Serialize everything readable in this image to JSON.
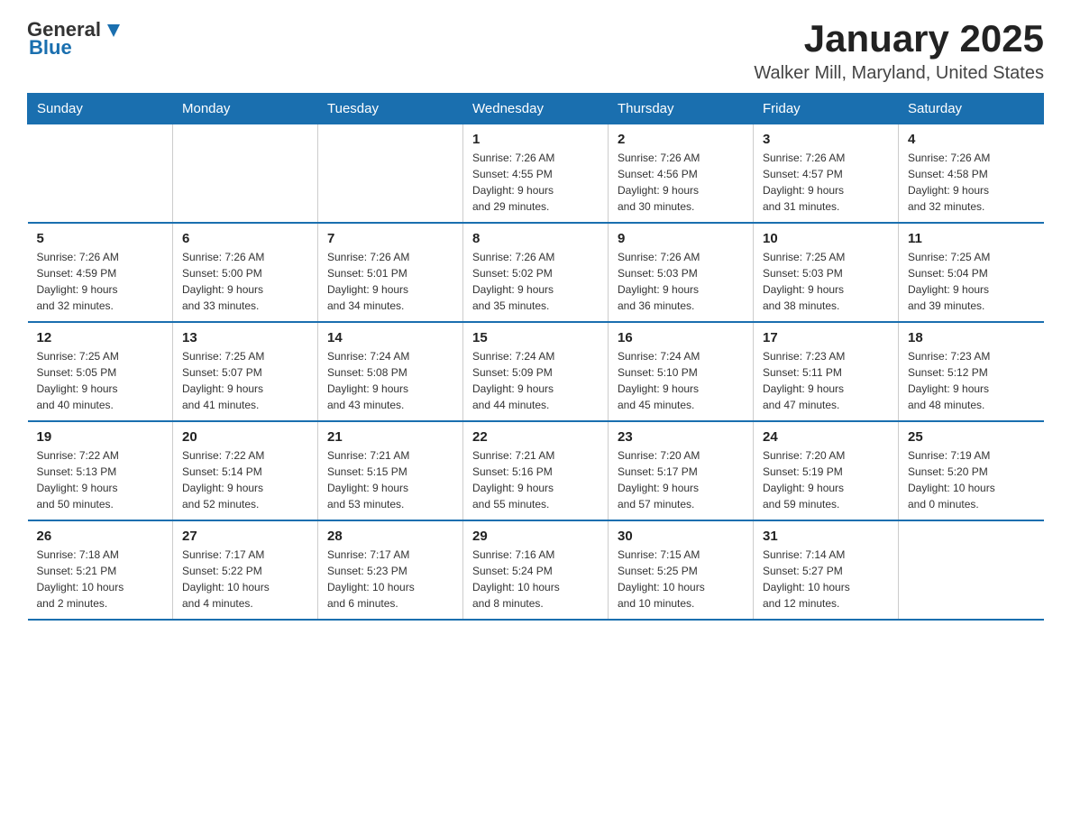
{
  "logo": {
    "general": "General",
    "blue": "Blue"
  },
  "title": "January 2025",
  "location": "Walker Mill, Maryland, United States",
  "weekdays": [
    "Sunday",
    "Monday",
    "Tuesday",
    "Wednesday",
    "Thursday",
    "Friday",
    "Saturday"
  ],
  "weeks": [
    [
      {
        "day": "",
        "info": ""
      },
      {
        "day": "",
        "info": ""
      },
      {
        "day": "",
        "info": ""
      },
      {
        "day": "1",
        "info": "Sunrise: 7:26 AM\nSunset: 4:55 PM\nDaylight: 9 hours\nand 29 minutes."
      },
      {
        "day": "2",
        "info": "Sunrise: 7:26 AM\nSunset: 4:56 PM\nDaylight: 9 hours\nand 30 minutes."
      },
      {
        "day": "3",
        "info": "Sunrise: 7:26 AM\nSunset: 4:57 PM\nDaylight: 9 hours\nand 31 minutes."
      },
      {
        "day": "4",
        "info": "Sunrise: 7:26 AM\nSunset: 4:58 PM\nDaylight: 9 hours\nand 32 minutes."
      }
    ],
    [
      {
        "day": "5",
        "info": "Sunrise: 7:26 AM\nSunset: 4:59 PM\nDaylight: 9 hours\nand 32 minutes."
      },
      {
        "day": "6",
        "info": "Sunrise: 7:26 AM\nSunset: 5:00 PM\nDaylight: 9 hours\nand 33 minutes."
      },
      {
        "day": "7",
        "info": "Sunrise: 7:26 AM\nSunset: 5:01 PM\nDaylight: 9 hours\nand 34 minutes."
      },
      {
        "day": "8",
        "info": "Sunrise: 7:26 AM\nSunset: 5:02 PM\nDaylight: 9 hours\nand 35 minutes."
      },
      {
        "day": "9",
        "info": "Sunrise: 7:26 AM\nSunset: 5:03 PM\nDaylight: 9 hours\nand 36 minutes."
      },
      {
        "day": "10",
        "info": "Sunrise: 7:25 AM\nSunset: 5:03 PM\nDaylight: 9 hours\nand 38 minutes."
      },
      {
        "day": "11",
        "info": "Sunrise: 7:25 AM\nSunset: 5:04 PM\nDaylight: 9 hours\nand 39 minutes."
      }
    ],
    [
      {
        "day": "12",
        "info": "Sunrise: 7:25 AM\nSunset: 5:05 PM\nDaylight: 9 hours\nand 40 minutes."
      },
      {
        "day": "13",
        "info": "Sunrise: 7:25 AM\nSunset: 5:07 PM\nDaylight: 9 hours\nand 41 minutes."
      },
      {
        "day": "14",
        "info": "Sunrise: 7:24 AM\nSunset: 5:08 PM\nDaylight: 9 hours\nand 43 minutes."
      },
      {
        "day": "15",
        "info": "Sunrise: 7:24 AM\nSunset: 5:09 PM\nDaylight: 9 hours\nand 44 minutes."
      },
      {
        "day": "16",
        "info": "Sunrise: 7:24 AM\nSunset: 5:10 PM\nDaylight: 9 hours\nand 45 minutes."
      },
      {
        "day": "17",
        "info": "Sunrise: 7:23 AM\nSunset: 5:11 PM\nDaylight: 9 hours\nand 47 minutes."
      },
      {
        "day": "18",
        "info": "Sunrise: 7:23 AM\nSunset: 5:12 PM\nDaylight: 9 hours\nand 48 minutes."
      }
    ],
    [
      {
        "day": "19",
        "info": "Sunrise: 7:22 AM\nSunset: 5:13 PM\nDaylight: 9 hours\nand 50 minutes."
      },
      {
        "day": "20",
        "info": "Sunrise: 7:22 AM\nSunset: 5:14 PM\nDaylight: 9 hours\nand 52 minutes."
      },
      {
        "day": "21",
        "info": "Sunrise: 7:21 AM\nSunset: 5:15 PM\nDaylight: 9 hours\nand 53 minutes."
      },
      {
        "day": "22",
        "info": "Sunrise: 7:21 AM\nSunset: 5:16 PM\nDaylight: 9 hours\nand 55 minutes."
      },
      {
        "day": "23",
        "info": "Sunrise: 7:20 AM\nSunset: 5:17 PM\nDaylight: 9 hours\nand 57 minutes."
      },
      {
        "day": "24",
        "info": "Sunrise: 7:20 AM\nSunset: 5:19 PM\nDaylight: 9 hours\nand 59 minutes."
      },
      {
        "day": "25",
        "info": "Sunrise: 7:19 AM\nSunset: 5:20 PM\nDaylight: 10 hours\nand 0 minutes."
      }
    ],
    [
      {
        "day": "26",
        "info": "Sunrise: 7:18 AM\nSunset: 5:21 PM\nDaylight: 10 hours\nand 2 minutes."
      },
      {
        "day": "27",
        "info": "Sunrise: 7:17 AM\nSunset: 5:22 PM\nDaylight: 10 hours\nand 4 minutes."
      },
      {
        "day": "28",
        "info": "Sunrise: 7:17 AM\nSunset: 5:23 PM\nDaylight: 10 hours\nand 6 minutes."
      },
      {
        "day": "29",
        "info": "Sunrise: 7:16 AM\nSunset: 5:24 PM\nDaylight: 10 hours\nand 8 minutes."
      },
      {
        "day": "30",
        "info": "Sunrise: 7:15 AM\nSunset: 5:25 PM\nDaylight: 10 hours\nand 10 minutes."
      },
      {
        "day": "31",
        "info": "Sunrise: 7:14 AM\nSunset: 5:27 PM\nDaylight: 10 hours\nand 12 minutes."
      },
      {
        "day": "",
        "info": ""
      }
    ]
  ]
}
